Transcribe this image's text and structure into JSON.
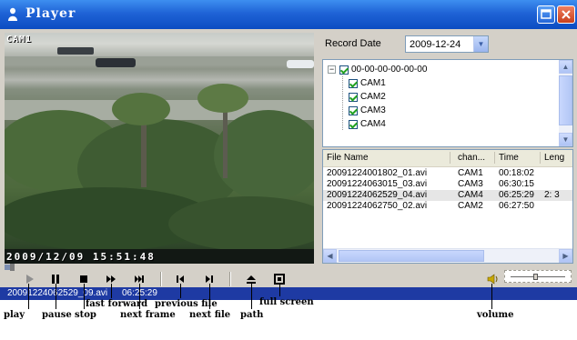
{
  "window": {
    "title": "Player"
  },
  "video": {
    "camera_label": "CAM1",
    "timestamp": "2009/12/09  15:51:48"
  },
  "record_date": {
    "label": "Record Date",
    "value": "2009-12-24"
  },
  "tree": {
    "root": "00-00-00-00-00-00",
    "cameras": [
      "CAM1",
      "CAM2",
      "CAM3",
      "CAM4"
    ]
  },
  "file_list": {
    "columns": [
      "File Name",
      "chan...",
      "Time",
      "Leng"
    ],
    "rows": [
      {
        "file": "20091224001802_01.avi",
        "channel": "CAM1",
        "time": "00:18:02",
        "length": ""
      },
      {
        "file": "20091224063015_03.avi",
        "channel": "CAM3",
        "time": "06:30:15",
        "length": ""
      },
      {
        "file": "20091224062529_04.avi",
        "channel": "CAM4",
        "time": "06:25:29",
        "length": "2: 3"
      },
      {
        "file": "20091224062750_02.avi",
        "channel": "CAM2",
        "time": "06:27:50",
        "length": ""
      }
    ]
  },
  "playback": {
    "progress_fraction": 0.02
  },
  "status": {
    "filename": "20091224062529_09.avi",
    "time": "06:25:29"
  },
  "volume": {
    "level_fraction": 0.45
  },
  "annotations": {
    "play": "play",
    "pause": "pause",
    "stop": "stop",
    "fast_forward": "fast forward",
    "next_frame": "next frame",
    "previous_file": "previous file",
    "next_file": "next file",
    "path": "path",
    "full_screen": "full screen",
    "volume": "volume"
  },
  "colors": {
    "title_bar": "#1f63d6",
    "status_bar": "#1e3aa3",
    "check": "#21a121"
  },
  "icons": [
    "player-app-icon",
    "maximize-icon",
    "close-icon",
    "play-icon",
    "pause-icon",
    "stop-icon",
    "fast-forward-icon",
    "next-frame-icon",
    "previous-file-icon",
    "next-file-icon",
    "path-icon",
    "full-screen-icon",
    "speaker-icon"
  ]
}
